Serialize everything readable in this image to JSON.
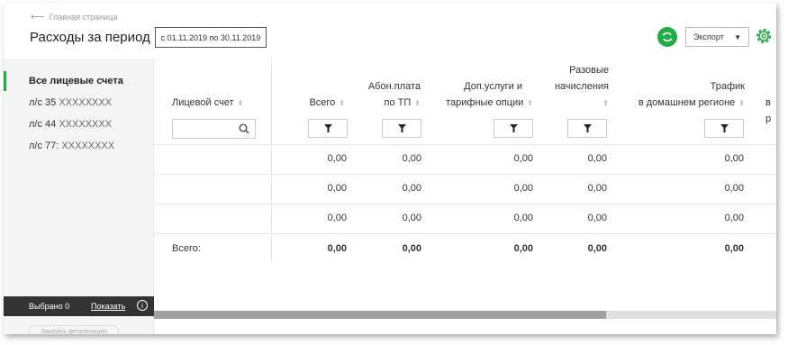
{
  "header": {
    "breadcrumb": "Главная страница",
    "title": "Расходы за период",
    "period": "с 01.11.2019 по 30.11.2019",
    "export_label": "Экспорт"
  },
  "sidebar": {
    "items": [
      {
        "label": "Все лицевые счета",
        "num": ""
      },
      {
        "label": "л/с 35",
        "num": "XXXXXXXX"
      },
      {
        "label": "л/с 44",
        "num": "XXXXXXXX"
      },
      {
        "label": "л/с 77:",
        "num": "XXXXXXXX"
      }
    ],
    "selected_label": "Выбрано 0",
    "show_label": "Показать",
    "order_label": "Заказать детализацию"
  },
  "table": {
    "columns": [
      {
        "line1": "",
        "line2": "Лицевой счет"
      },
      {
        "line1": "",
        "line2": "Всего"
      },
      {
        "line1": "Абон.плата",
        "line2": "по ТП"
      },
      {
        "line1": "Доп.услуги и",
        "line2": "тарифные опции"
      },
      {
        "line1": "Разовые",
        "line2": "начисления"
      },
      {
        "line1": "Трафик",
        "line2": "в домашнем регионе"
      },
      {
        "line1": "",
        "line2": "в р"
      }
    ],
    "rows": [
      [
        "0,00",
        "0,00",
        "0,00",
        "0,00",
        "0,00"
      ],
      [
        "0,00",
        "0,00",
        "0,00",
        "0,00",
        "0,00"
      ],
      [
        "0,00",
        "0,00",
        "0,00",
        "0,00",
        "0,00"
      ]
    ],
    "total_label": "Всего:",
    "totals": [
      "0,00",
      "0,00",
      "0,00",
      "0,00",
      "0,00"
    ]
  },
  "colors": {
    "accent": "#1fae45",
    "dark_bar": "#333333"
  },
  "icons": {
    "back": "arrow-left-icon",
    "refresh": "refresh-icon",
    "settings": "gear-icon",
    "search": "search-icon",
    "filter": "filter-icon",
    "info": "info-icon"
  }
}
